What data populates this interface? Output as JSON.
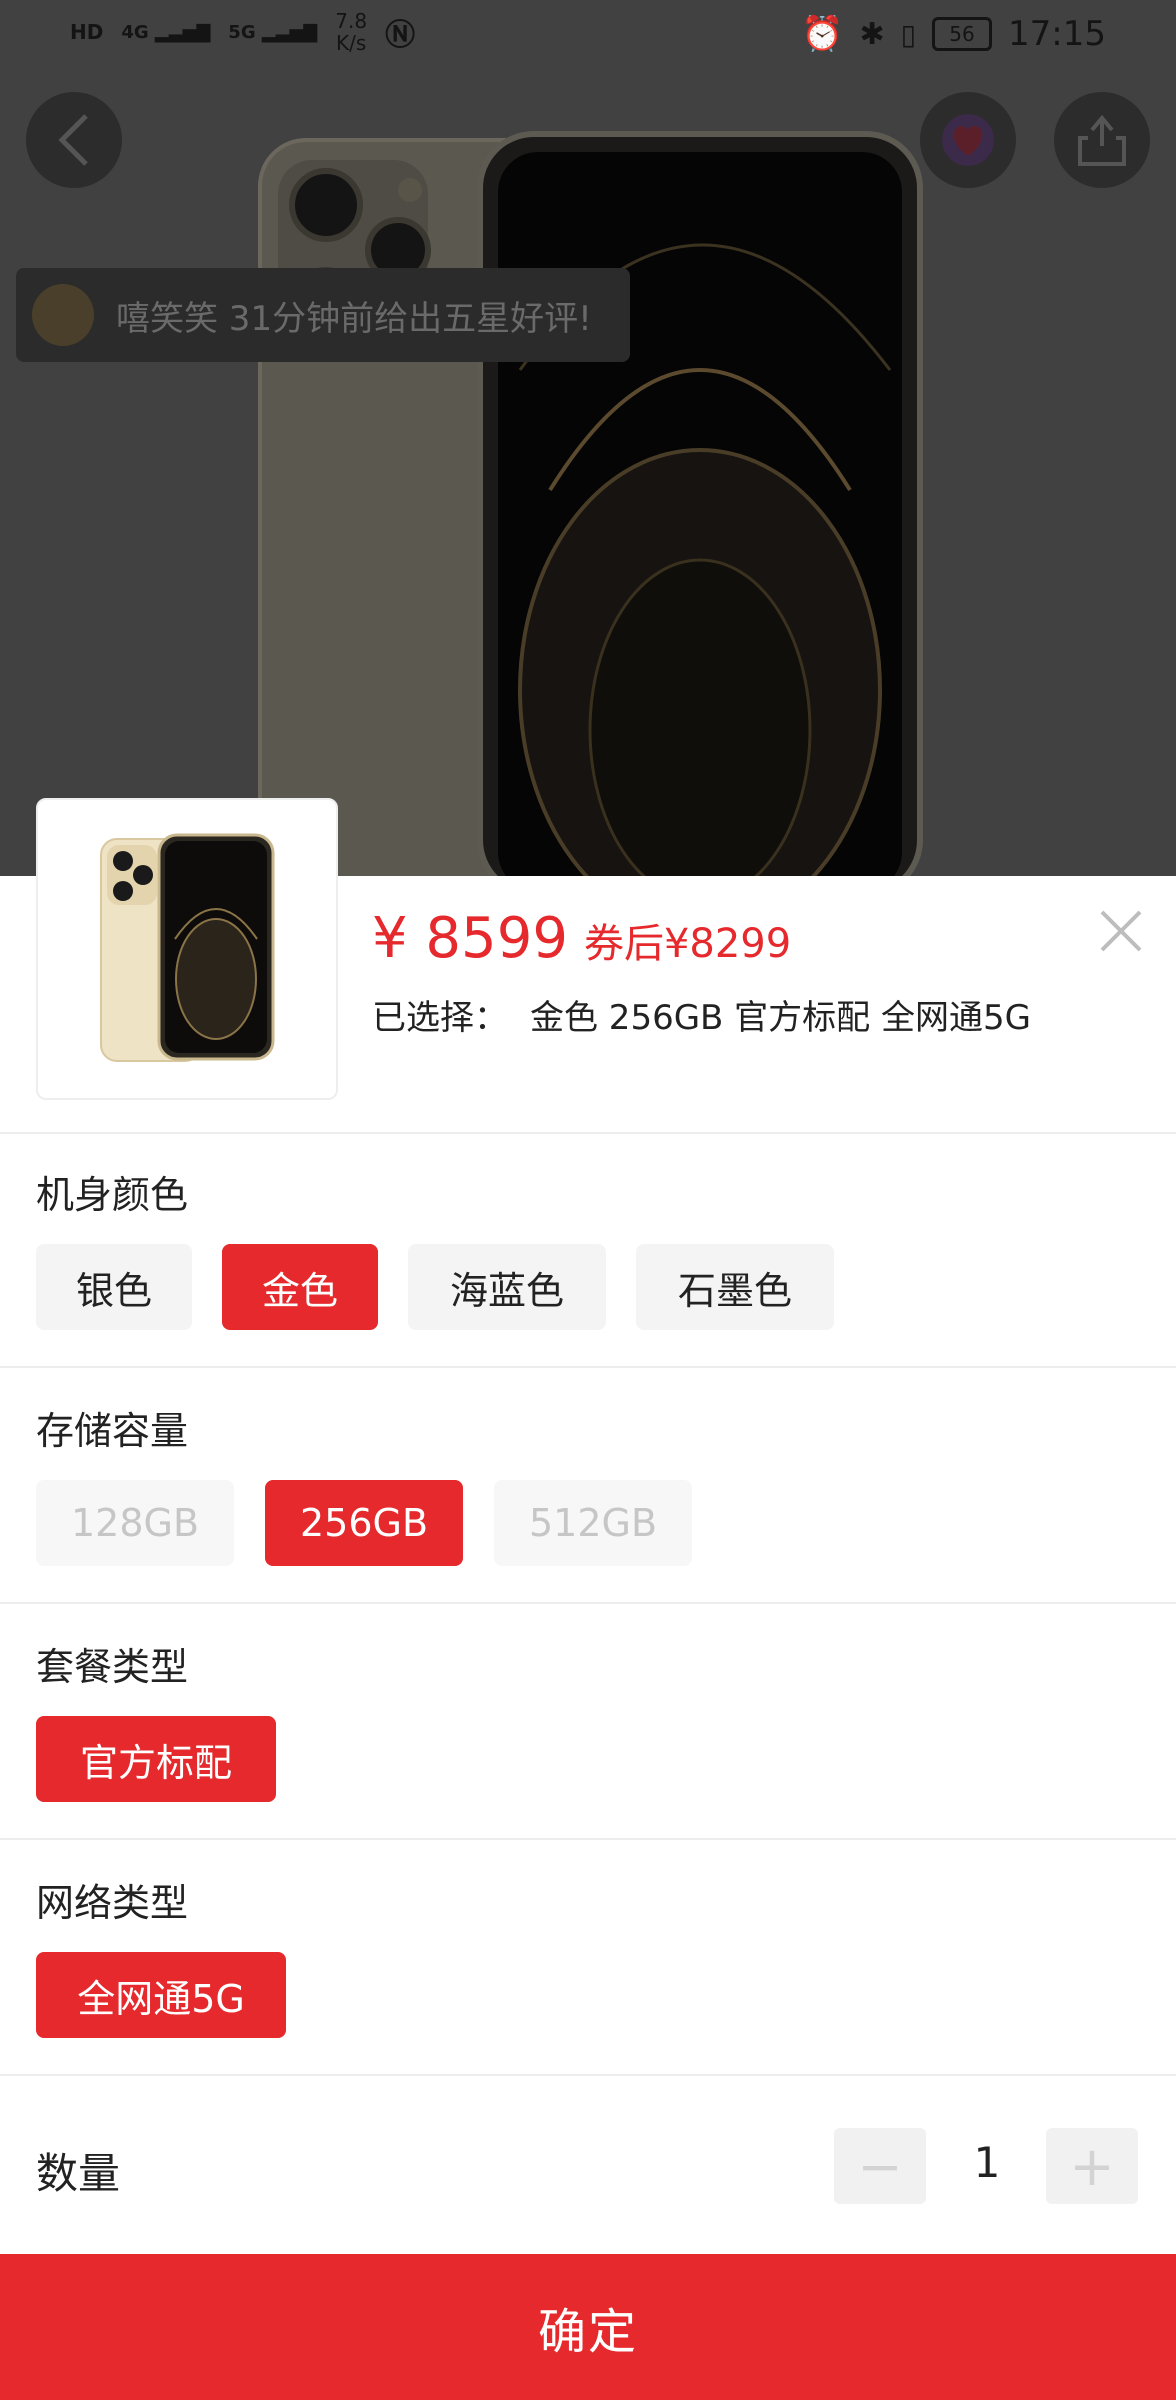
{
  "status_bar": {
    "net_speed_value": "7.8",
    "net_speed_unit": "K/s",
    "battery": "56",
    "time": "17:15",
    "hd_label": "HD",
    "signal_4g": "4G",
    "signal_5g": "5G"
  },
  "review_toast": {
    "text": "嘻笑笑 31分钟前给出五星好评!"
  },
  "product": {
    "price": "¥ 8599",
    "coupon_price": "券后¥8299",
    "selected_label": "已选择：",
    "selected_value": "金色 256GB 官方标配 全网通5G"
  },
  "sections": {
    "color": {
      "title": "机身颜色",
      "options": [
        "银色",
        "金色",
        "海蓝色",
        "石墨色"
      ],
      "selected": "金色"
    },
    "storage": {
      "title": "存储容量",
      "options": [
        "128GB",
        "256GB",
        "512GB"
      ],
      "selected": "256GB",
      "disabled": [
        "128GB",
        "512GB"
      ]
    },
    "package": {
      "title": "套餐类型",
      "options": [
        "官方标配"
      ],
      "selected": "官方标配"
    },
    "network": {
      "title": "网络类型",
      "options": [
        "全网通5G"
      ],
      "selected": "全网通5G"
    }
  },
  "quantity": {
    "label": "数量",
    "value": "1",
    "minus": "−",
    "plus": "+"
  },
  "confirm_label": "确定",
  "colors": {
    "accent": "#e5292c",
    "chip_bg": "#f4f4f4",
    "overlay": "#414141"
  },
  "icons": [
    "back-icon",
    "heart-icon",
    "share-icon",
    "close-icon",
    "alarm-icon",
    "bluetooth-icon",
    "vibrate-icon",
    "nfc-icon"
  ]
}
